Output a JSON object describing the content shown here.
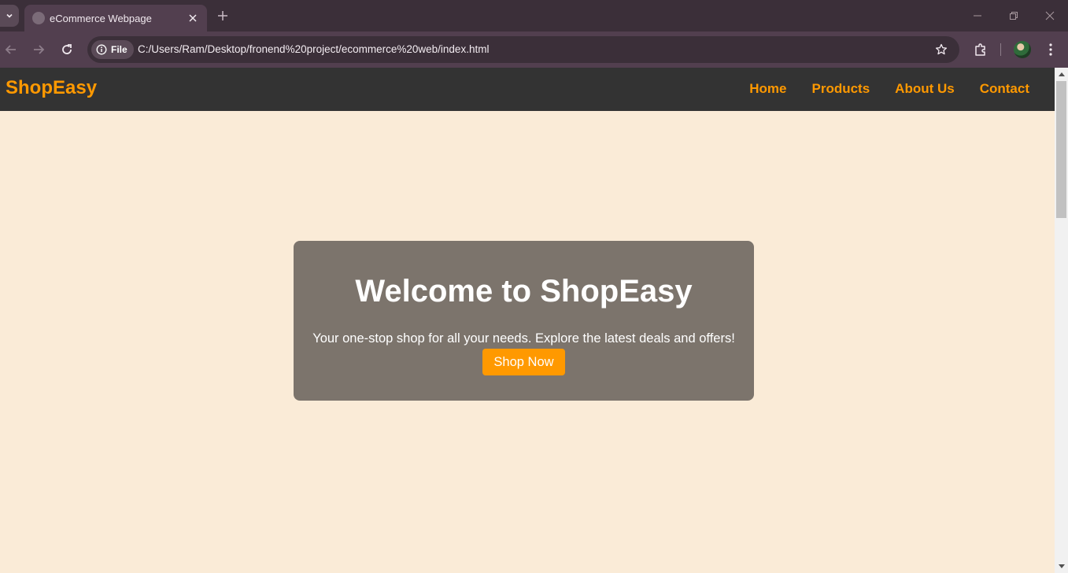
{
  "browser": {
    "tab_title": "eCommerce Webpage",
    "url_chip": "File",
    "url": "C:/Users/Ram/Desktop/fronend%20project/ecommerce%20web/index.html"
  },
  "site": {
    "logo": "ShopEasy",
    "nav": [
      "Home",
      "Products",
      "About Us",
      "Contact"
    ],
    "hero": {
      "title": "Welcome to ShopEasy",
      "text": "Your one-stop shop for all your needs. Explore the latest deals and offers!",
      "button": "Shop Now"
    }
  },
  "colors": {
    "accent": "#ff9900",
    "header_bg": "#333333",
    "page_bg": "#faebd7",
    "hero_bg": "#7c746c"
  },
  "icons": [
    "tab-list-icon",
    "globe-icon",
    "close-icon",
    "plus-icon",
    "minimize-icon",
    "restore-icon",
    "back-icon",
    "forward-icon",
    "reload-icon",
    "info-icon",
    "star-icon",
    "extensions-icon",
    "avatar",
    "kebab-menu-icon"
  ]
}
